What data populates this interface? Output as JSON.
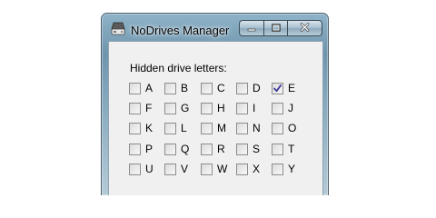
{
  "window": {
    "title": "NoDrives Manager",
    "app_icon": "drive-icon"
  },
  "caption_buttons": {
    "minimize_icon": "minimize-icon",
    "maximize_icon": "maximize-icon",
    "close_icon": "close-icon"
  },
  "hidden_drives": {
    "label": "Hidden drive letters:",
    "rows": [
      [
        {
          "letter": "A",
          "checked": false
        },
        {
          "letter": "B",
          "checked": false
        },
        {
          "letter": "C",
          "checked": false
        },
        {
          "letter": "D",
          "checked": false
        },
        {
          "letter": "E",
          "checked": true
        }
      ],
      [
        {
          "letter": "F",
          "checked": false
        },
        {
          "letter": "G",
          "checked": false
        },
        {
          "letter": "H",
          "checked": false
        },
        {
          "letter": "I",
          "checked": false
        },
        {
          "letter": "J",
          "checked": false
        }
      ],
      [
        {
          "letter": "K",
          "checked": false
        },
        {
          "letter": "L",
          "checked": false
        },
        {
          "letter": "M",
          "checked": false
        },
        {
          "letter": "N",
          "checked": false
        },
        {
          "letter": "O",
          "checked": false
        }
      ],
      [
        {
          "letter": "P",
          "checked": false
        },
        {
          "letter": "Q",
          "checked": false
        },
        {
          "letter": "R",
          "checked": false
        },
        {
          "letter": "S",
          "checked": false
        },
        {
          "letter": "T",
          "checked": false
        }
      ],
      [
        {
          "letter": "U",
          "checked": false
        },
        {
          "letter": "V",
          "checked": false
        },
        {
          "letter": "W",
          "checked": false
        },
        {
          "letter": "X",
          "checked": false
        },
        {
          "letter": "Y",
          "checked": false
        }
      ]
    ]
  },
  "colors": {
    "check_mark": "#3a3a9a",
    "titlebar": "#7ea3b9",
    "client_background": "#f0f0f0"
  }
}
